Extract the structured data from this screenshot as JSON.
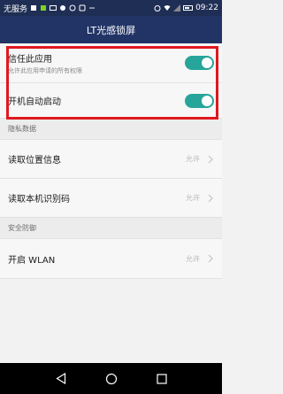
{
  "status_bar": {
    "carrier": "无服务",
    "time": "09:22"
  },
  "header": {
    "title": "LT光感锁屏"
  },
  "top_items": [
    {
      "title": "信任此应用",
      "subtitle": "允许此应用申请的所有权限",
      "toggle_on": true
    },
    {
      "title": "开机自动启动",
      "toggle_on": true
    }
  ],
  "sections": [
    {
      "header": "隐私数据",
      "items": [
        {
          "title": "读取位置信息",
          "value": "允许"
        },
        {
          "title": "读取本机识别码",
          "value": "允许"
        }
      ]
    },
    {
      "header": "安全防御",
      "items": [
        {
          "title": "开启 WLAN",
          "value": "允许"
        }
      ]
    }
  ],
  "colors": {
    "header_bg": "#223466",
    "toggle_on": "#27a59a",
    "highlight_border": "#e0181f"
  },
  "icons": [
    "back-icon",
    "home-icon",
    "recents-icon",
    "chevron-right-icon",
    "wifi-icon",
    "signal-icon",
    "battery-icon",
    "alarm-icon"
  ]
}
